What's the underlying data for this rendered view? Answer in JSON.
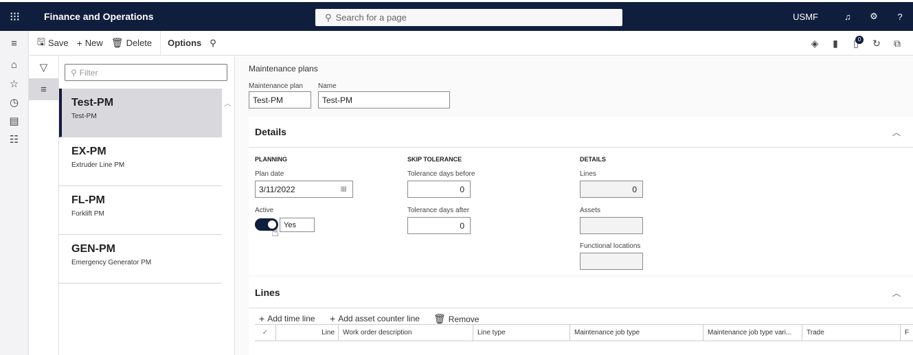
{
  "app": {
    "title": "Finance and Operations",
    "search_placeholder": "Search for a page",
    "company": "USMF"
  },
  "icons": {
    "waffle": "⋮⋮⋮",
    "bell": "🔔",
    "gear": "⚙",
    "help": "?",
    "search": "⌕"
  },
  "actionbar": {
    "save_label": "Save",
    "new_label": "New",
    "delete_label": "Delete",
    "options_label": "Options",
    "notification_count": "0"
  },
  "listpane": {
    "filter_placeholder": "Filter",
    "items": [
      {
        "code": "Test-PM",
        "description": "Test-PM",
        "selected": true
      },
      {
        "code": "EX-PM",
        "description": "Extruder Line PM",
        "selected": false
      },
      {
        "code": "FL-PM",
        "description": "Forklift PM",
        "selected": false
      },
      {
        "code": "GEN-PM",
        "description": "Emergency Generator PM",
        "selected": false
      }
    ]
  },
  "header": {
    "breadcrumb": "Maintenance plans",
    "plan_label": "Maintenance plan",
    "plan_value": "Test-PM",
    "name_label": "Name",
    "name_value": "Test-PM"
  },
  "details": {
    "title": "Details",
    "planning": {
      "heading": "PLANNING",
      "plan_date_label": "Plan date",
      "plan_date_value": "3/11/2022",
      "active_label": "Active",
      "active_value": "Yes"
    },
    "skip_tolerance": {
      "heading": "SKIP TOLERANCE",
      "before_label": "Tolerance days before",
      "before_value": "0",
      "after_label": "Tolerance days after",
      "after_value": "0"
    },
    "details_group": {
      "heading": "DETAILS",
      "lines_label": "Lines",
      "lines_value": "0",
      "assets_label": "Assets",
      "assets_value": "",
      "functional_locations_label": "Functional locations",
      "functional_locations_value": ""
    }
  },
  "lines": {
    "title": "Lines",
    "add_time_line": "Add time line",
    "add_asset_counter_line": "Add asset counter line",
    "remove": "Remove",
    "columns": [
      "Line",
      "Work order description",
      "Line type",
      "Maintenance job type",
      "Maintenance job type vari...",
      "Trade",
      "F"
    ]
  }
}
